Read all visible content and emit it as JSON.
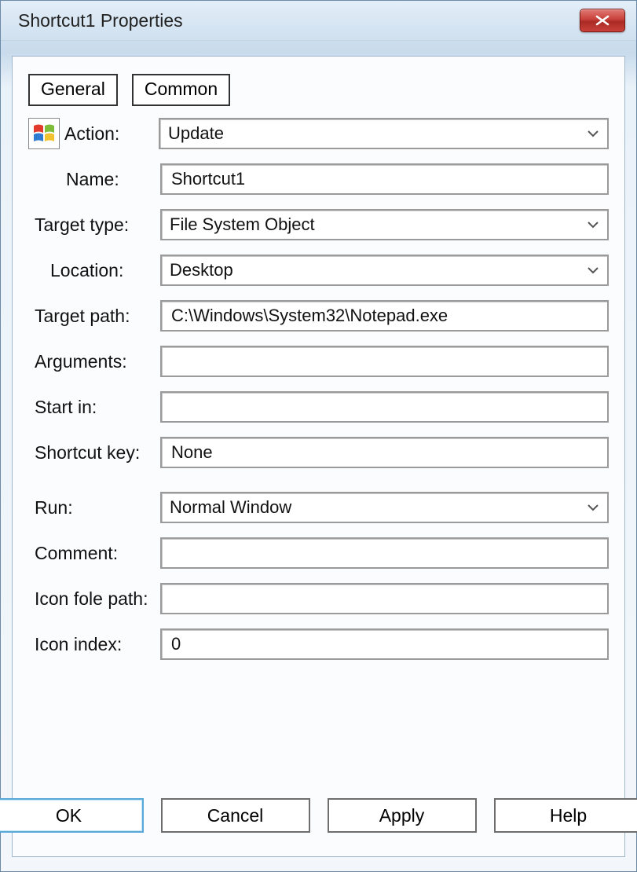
{
  "title": "Shortcut1 Properties",
  "tabs": {
    "general": "General",
    "common": "Common"
  },
  "labels": {
    "action": "Action:",
    "name": "Name:",
    "target_type": "Target type:",
    "location": "Location:",
    "target_path": "Target path:",
    "arguments": "Arguments:",
    "start_in": "Start in:",
    "shortcut_key": "Shortcut key:",
    "run": "Run:",
    "comment": "Comment:",
    "icon_path": "Icon fole path:",
    "icon_index": "Icon index:"
  },
  "values": {
    "action": "Update",
    "name": "Shortcut1",
    "target_type": "File System Object",
    "location": "Desktop",
    "target_path": "C:\\Windows\\System32\\Notepad.exe",
    "arguments": "",
    "start_in": "",
    "shortcut_key": "None",
    "run": "Normal Window",
    "comment": "",
    "icon_path": "",
    "icon_index": "0"
  },
  "buttons": {
    "ok": "OK",
    "cancel": "Cancel",
    "apply": "Apply",
    "help": "Help"
  }
}
